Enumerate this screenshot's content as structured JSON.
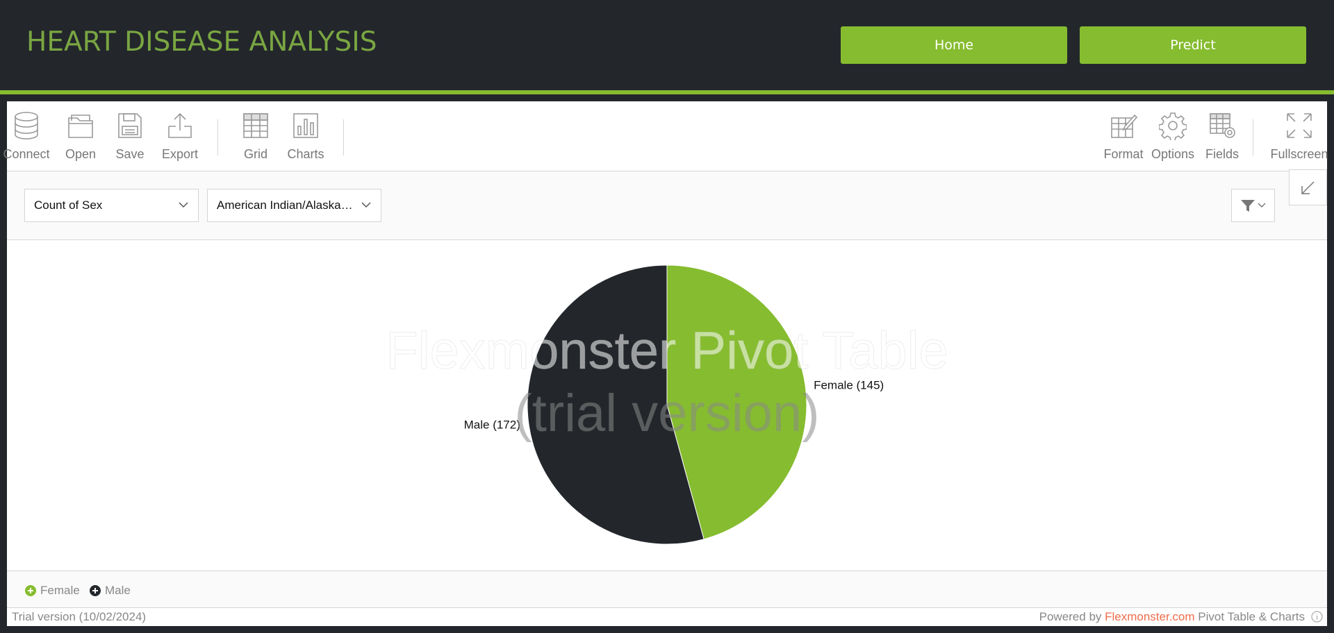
{
  "header": {
    "title": "HEART DISEASE ANALYSIS",
    "nav": {
      "home": "Home",
      "predict": "Predict"
    }
  },
  "toolbar": {
    "connect": "Connect",
    "open": "Open",
    "save": "Save",
    "export": "Export",
    "grid": "Grid",
    "charts": "Charts",
    "format": "Format",
    "options": "Options",
    "fields": "Fields",
    "fullscreen": "Fullscreen"
  },
  "filters": {
    "measure": "Count of Sex",
    "race": "American Indian/Alaskan Native"
  },
  "watermark": {
    "line1": "Flexmonster Pivot Table",
    "line2": "(trial version)"
  },
  "chart_data": {
    "type": "pie",
    "categories": [
      "Female",
      "Male"
    ],
    "values": [
      145,
      172
    ],
    "labels": [
      "Female (145)",
      "Male (172)"
    ],
    "colors": [
      "#86bc2f",
      "#23272b"
    ]
  },
  "legend": [
    {
      "label": "Female",
      "color": "#86bc2f"
    },
    {
      "label": "Male",
      "color": "#23272b"
    }
  ],
  "footer": {
    "trial": "Trial version (10/02/2024)",
    "powered_prefix": "Powered by ",
    "powered_link": "Flexmonster.com",
    "powered_suffix": " Pivot Table & Charts"
  },
  "colors": {
    "accent": "#86bc2f",
    "dark": "#23272b",
    "link": "#ef6c4a"
  }
}
